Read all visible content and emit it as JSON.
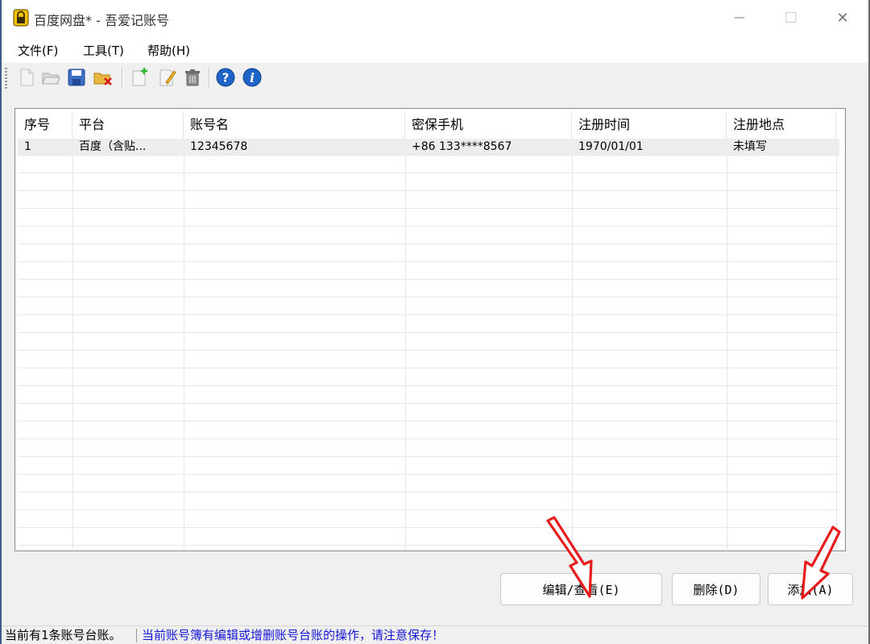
{
  "window": {
    "title": "百度网盘* - 吾爱记账号",
    "minimize_glyph": "—",
    "maximize_glyph": "☐",
    "close_glyph": "✕"
  },
  "menu": [
    {
      "label": "文件(F)"
    },
    {
      "label": "工具(T)"
    },
    {
      "label": "帮助(H)"
    }
  ],
  "toolbar": {
    "icons": [
      "new-file-icon",
      "open-folder-icon",
      "save-icon",
      "close-file-icon",
      "add-record-icon",
      "edit-record-icon",
      "delete-record-icon",
      "help-icon",
      "info-icon"
    ]
  },
  "table": {
    "columns": [
      "序号",
      "平台",
      "账号名",
      "密保手机",
      "注册时间",
      "注册地点"
    ],
    "rows": [
      [
        "1",
        "百度（含贴...",
        "12345678",
        "+86 133****8567",
        "1970/01/01",
        "未填写"
      ]
    ]
  },
  "buttons": {
    "edit_label": "编辑/查看(E)",
    "delete_label": "删除(D)",
    "add_label": "添加(A)"
  },
  "status": {
    "left": "当前有1条账号台账。",
    "right": "当前账号簿有编辑或增删账号台账的操作，请注意保存！"
  },
  "colors": {
    "accent_blue": "#1515d6",
    "annotation_red": "#e81c1c"
  }
}
